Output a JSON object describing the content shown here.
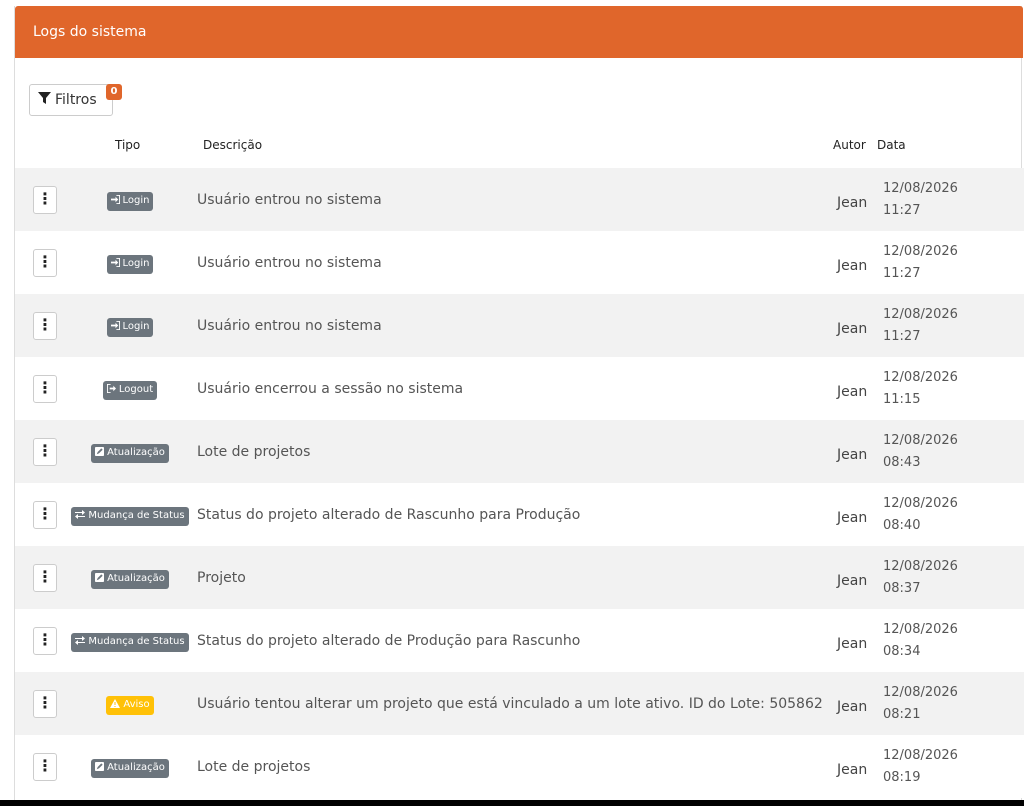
{
  "panel": {
    "title": "Logs do sistema"
  },
  "filters": {
    "label": "Filtros",
    "count": "0"
  },
  "columns": {
    "type": "Tipo",
    "description": "Descrição",
    "author": "Autor",
    "date": "Data"
  },
  "colors": {
    "accent": "#e0662b",
    "badge_default": "#6c757d",
    "badge_warning": "#ffc107"
  },
  "rows": [
    {
      "type": "Login",
      "type_icon": "sign-in-icon",
      "description": "Usuário entrou no sistema",
      "author": "Jean",
      "date": "12/08/2026",
      "time": "11:27"
    },
    {
      "type": "Login",
      "type_icon": "sign-in-icon",
      "description": "Usuário entrou no sistema",
      "author": "Jean",
      "date": "12/08/2026",
      "time": "11:27"
    },
    {
      "type": "Login",
      "type_icon": "sign-in-icon",
      "description": "Usuário entrou no sistema",
      "author": "Jean",
      "date": "12/08/2026",
      "time": "11:27"
    },
    {
      "type": "Logout",
      "type_icon": "sign-out-icon",
      "description": "Usuário encerrou a sessão no sistema",
      "author": "Jean",
      "date": "12/08/2026",
      "time": "11:15"
    },
    {
      "type": "Atualização",
      "type_icon": "edit-icon",
      "description": "Lote de projetos",
      "author": "Jean",
      "date": "12/08/2026",
      "time": "08:43"
    },
    {
      "type": "Mudança de Status",
      "type_icon": "exchange-icon",
      "description": "Status do projeto alterado de Rascunho para Produção",
      "author": "Jean",
      "date": "12/08/2026",
      "time": "08:40"
    },
    {
      "type": "Atualização",
      "type_icon": "edit-icon",
      "description": "Projeto",
      "author": "Jean",
      "date": "12/08/2026",
      "time": "08:37"
    },
    {
      "type": "Mudança de Status",
      "type_icon": "exchange-icon",
      "description": "Status do projeto alterado de Produção para Rascunho",
      "author": "Jean",
      "date": "12/08/2026",
      "time": "08:34"
    },
    {
      "type": "Aviso",
      "type_icon": "warning-icon",
      "description": "Usuário tentou alterar um projeto que está vinculado a um lote ativo. ID do Lote: 505862",
      "author": "Jean",
      "date": "12/08/2026",
      "time": "08:21"
    },
    {
      "type": "Atualização",
      "type_icon": "edit-icon",
      "description": "Lote de projetos",
      "author": "Jean",
      "date": "12/08/2026",
      "time": "08:19"
    }
  ]
}
